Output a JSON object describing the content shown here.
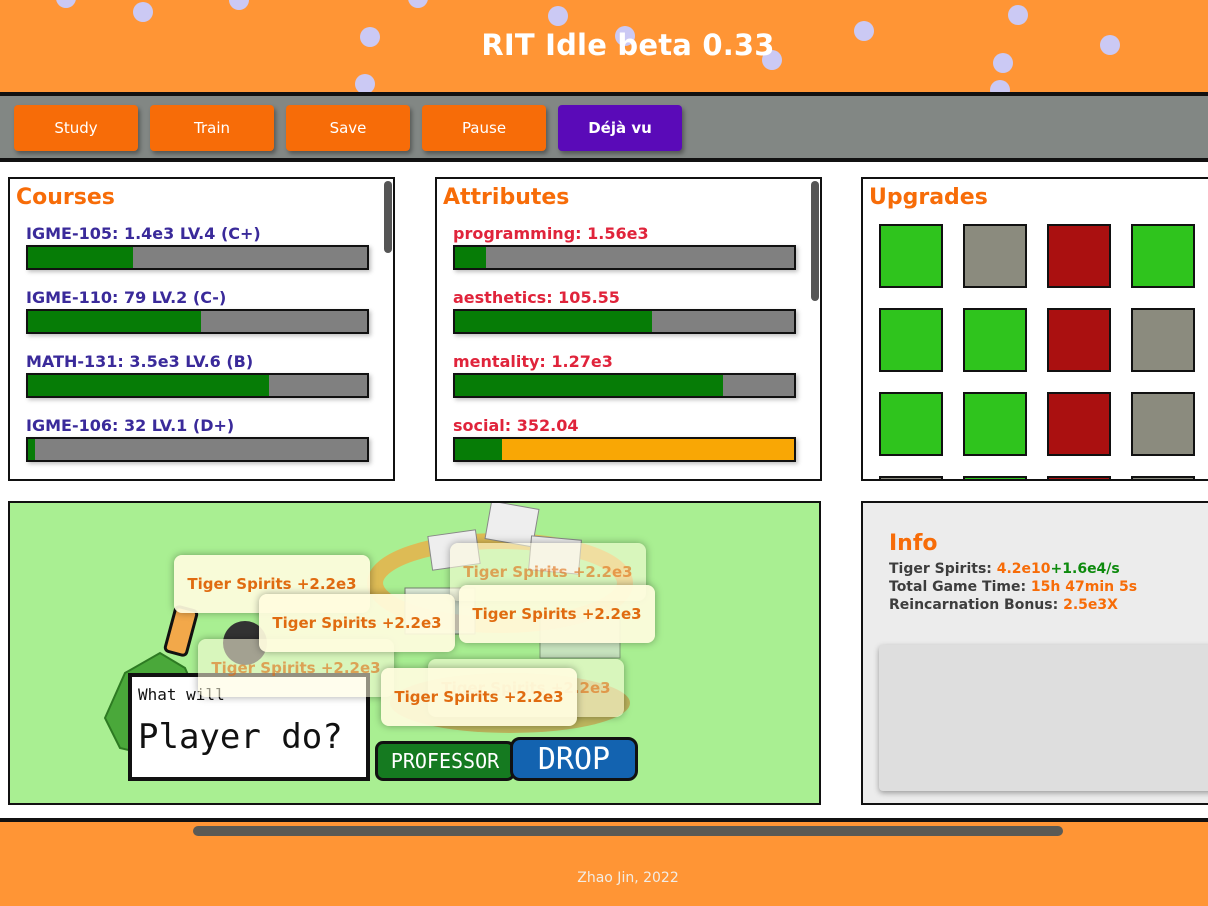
{
  "header": {
    "title": "RIT Idle beta 0.33"
  },
  "toolbar": {
    "buttons": [
      "Study",
      "Train",
      "Save",
      "Pause",
      "Déjà vu"
    ]
  },
  "courses": {
    "title": "Courses",
    "items": [
      {
        "label": "IGME-105: 1.4e3 LV.4 (C+)",
        "progress": 0.31
      },
      {
        "label": "IGME-110: 79 LV.2 (C-)",
        "progress": 0.51
      },
      {
        "label": "MATH-131: 3.5e3 LV.6 (B)",
        "progress": 0.71
      },
      {
        "label": "IGME-106: 32 LV.1 (D+)",
        "progress": 0.02
      }
    ]
  },
  "attributes": {
    "title": "Attributes",
    "items": [
      {
        "label": "programming: 1.56e3",
        "progress": 0.09
      },
      {
        "label": "aesthetics: 105.55",
        "progress": 0.58
      },
      {
        "label": "mentality: 1.27e3",
        "progress": 0.79
      },
      {
        "label": "social: 352.04",
        "progress": 0.14
      }
    ]
  },
  "upgrades": {
    "title": "Upgrades",
    "colors": {
      "green": "#2fc41d",
      "gray": "#8b8b7e",
      "red": "#aa1010"
    },
    "grid": [
      [
        "green",
        "gray",
        "red",
        "green"
      ],
      [
        "green",
        "green",
        "red",
        "gray"
      ],
      [
        "green",
        "green",
        "red",
        "gray"
      ]
    ]
  },
  "game": {
    "sign_line1": "What will",
    "sign_line2": "Player do?",
    "professor_label": "PROFESSOR",
    "drop_label": "DROP",
    "popups": [
      "Tiger Spirits +2.2e3",
      "Tiger Spirits +2.2e3",
      "Tiger Spirits +2.2e3",
      "Tiger Spirits +2.2e3",
      "Tiger Spirits +2.2e3",
      "Tiger Spirits +2.2e3",
      "Tiger Spirits +2.2e3"
    ]
  },
  "info": {
    "title": "Info",
    "tiger_label": "Tiger Spirits:",
    "tiger_value": "4.2e10",
    "tiger_rate": "+1.6e4/s",
    "time_label": "Total Game Time:",
    "time_value": "15h 47min 5s",
    "bonus_label": "Reincarnation Bonus:",
    "bonus_value": "2.5e3X"
  },
  "footer": {
    "text": "Zhao Jin, 2022"
  }
}
